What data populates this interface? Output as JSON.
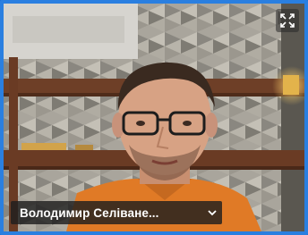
{
  "participant": {
    "name": "Володимир Селіване..."
  },
  "icons": {
    "fullscreen": "fullscreen-icon",
    "chevron": "chevron-down-icon"
  },
  "colors": {
    "frame_border": "#2a7fe0",
    "name_bar_bg": "#1e1e1e"
  }
}
